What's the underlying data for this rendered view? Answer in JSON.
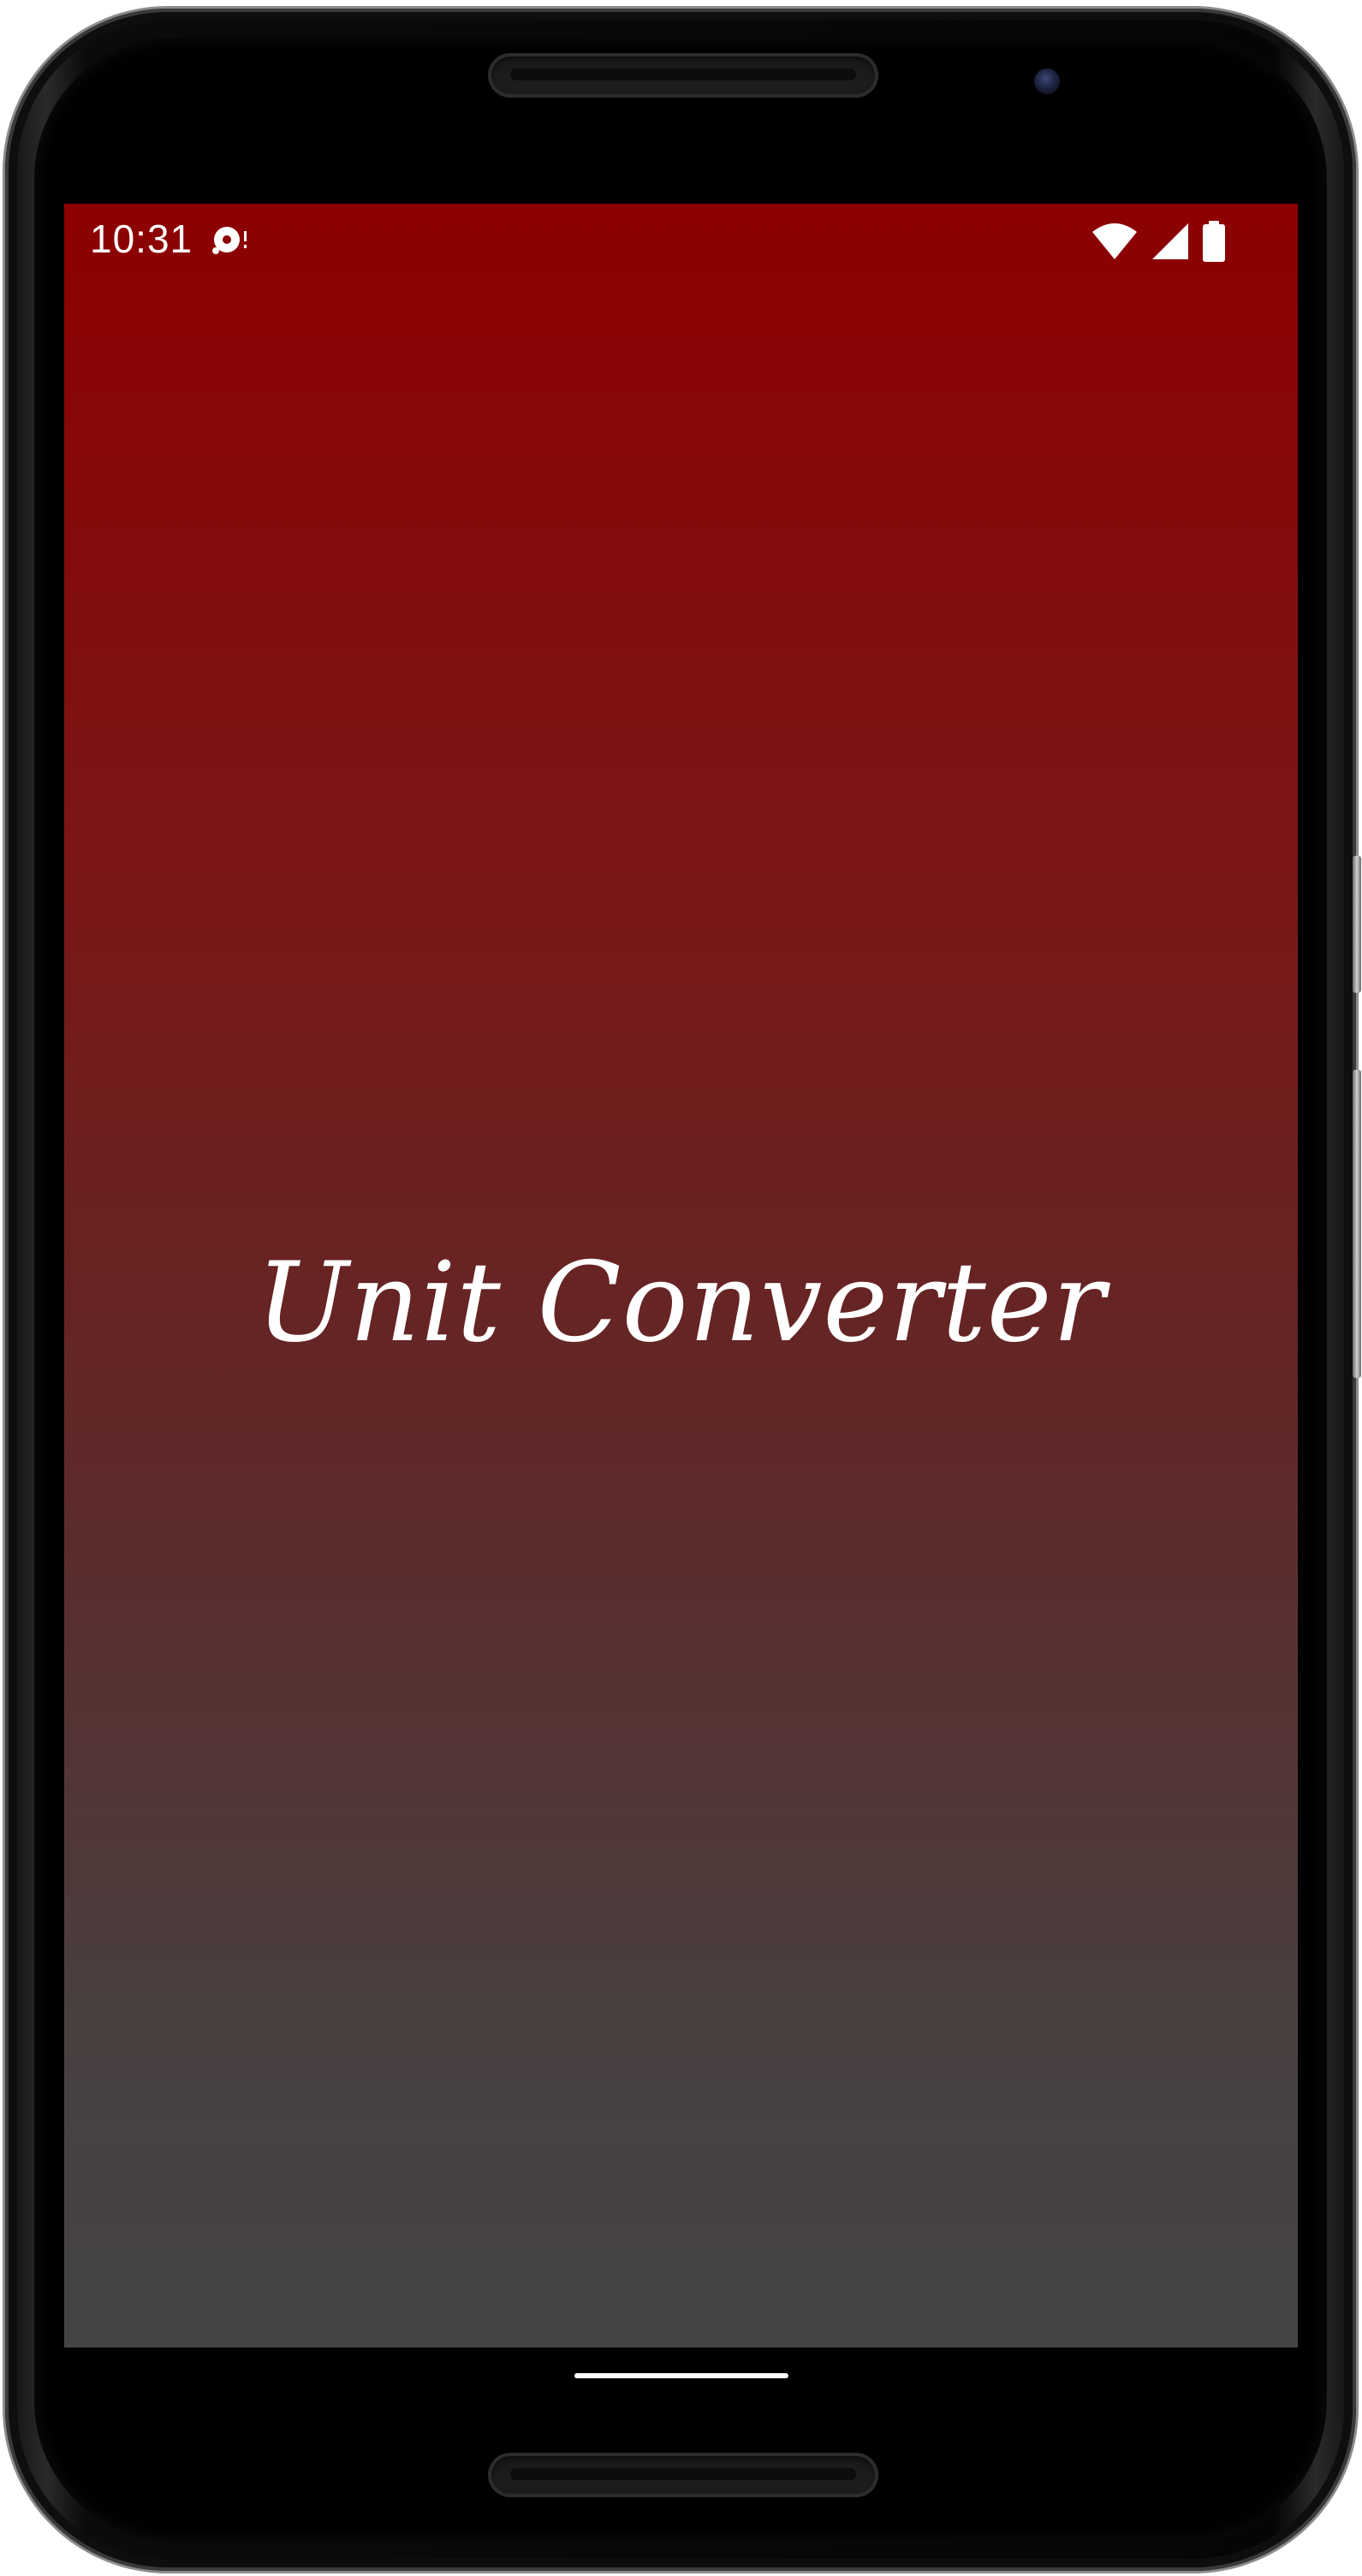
{
  "device": {
    "frame_color": "#0b0b0b",
    "speaker_icon": "speaker-grille",
    "camera_icon": "front-camera"
  },
  "status_bar": {
    "time": "10:31",
    "notification_icon": "media-notification-icon",
    "wifi_icon": "wifi-icon",
    "signal_icon": "cell-signal-icon",
    "battery_icon": "battery-icon"
  },
  "app": {
    "title": "Unit Converter",
    "gradient_top": "#8d0000",
    "gradient_bottom": "#444444",
    "text_color": "#ffffff"
  },
  "navigation": {
    "home_handle_icon": "gesture-home-handle"
  }
}
